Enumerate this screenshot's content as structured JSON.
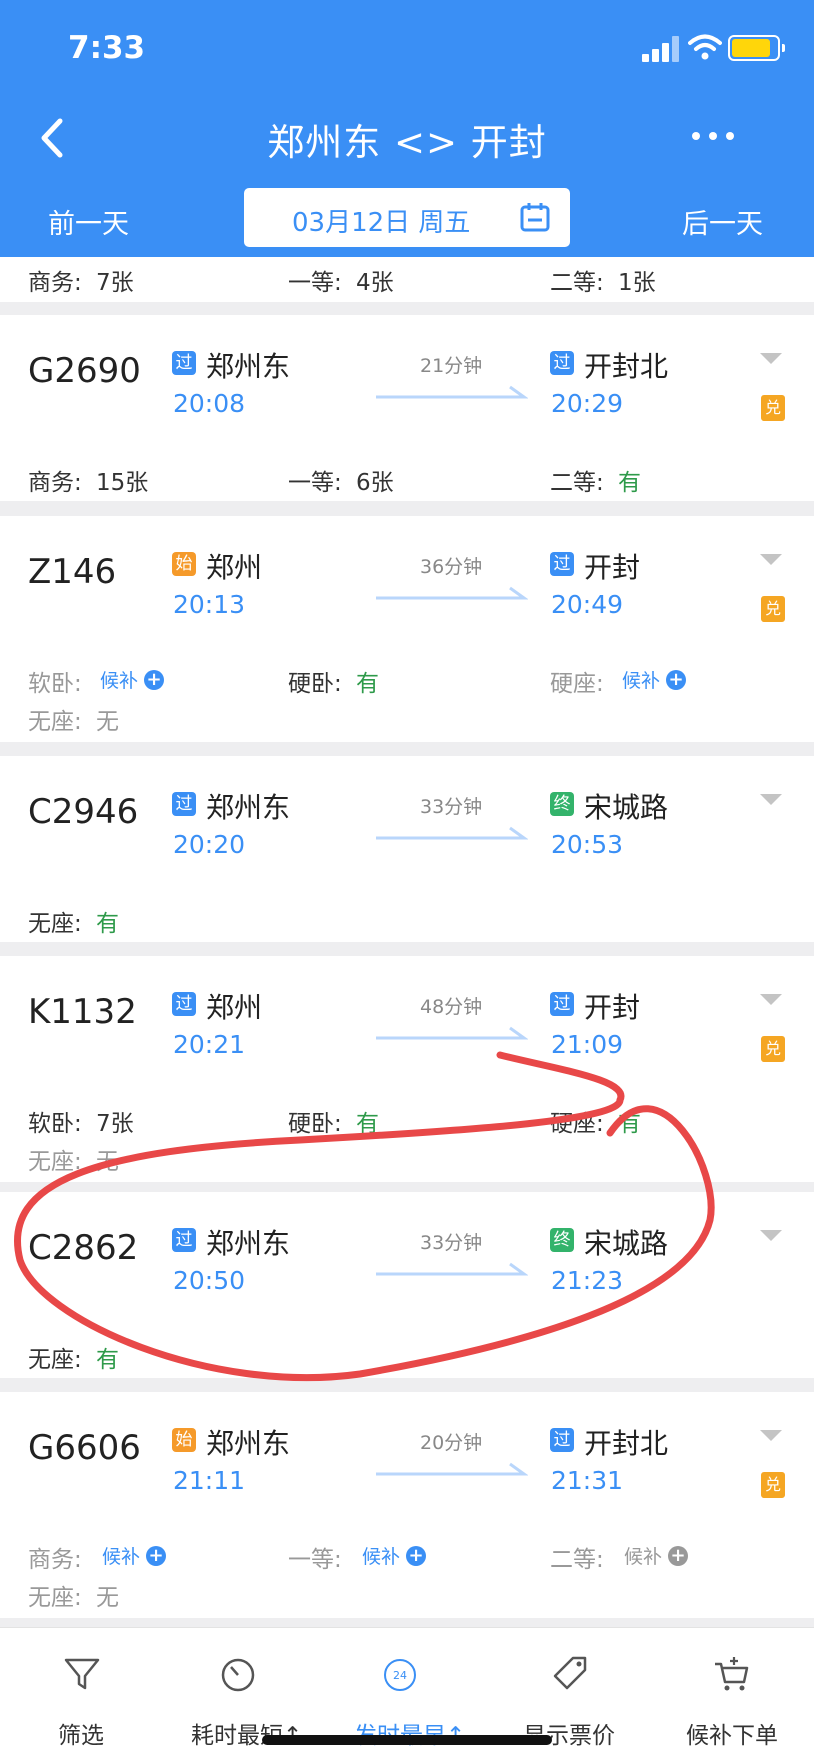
{
  "status_bar": {
    "time": "7:33"
  },
  "header": {
    "title": "郑州东 <> 开封",
    "prev_day": "前一天",
    "next_day": "后一天",
    "date": "03月12日 周五"
  },
  "partial_row": {
    "seats": [
      {
        "label": "商务:",
        "value": "7张",
        "status": "gray"
      },
      {
        "label": "一等:",
        "value": "4张",
        "status": "gray"
      },
      {
        "label": "二等:",
        "value": "1张",
        "status": "gray"
      }
    ]
  },
  "trains": [
    {
      "number": "G2690",
      "from_badge": "过",
      "from_type": "pass",
      "from": "郑州东",
      "dep": "20:08",
      "duration": "21分钟",
      "to_badge": "过",
      "to_type": "pass",
      "to": "开封北",
      "arr": "20:29",
      "exchange": "兑",
      "seats_row1": [
        {
          "label": "商务:",
          "value": "15张",
          "status": "gray"
        },
        {
          "label": "一等:",
          "value": "6张",
          "status": "gray"
        },
        {
          "label": "二等:",
          "value": "有",
          "status": "green"
        }
      ]
    },
    {
      "number": "Z146",
      "from_badge": "始",
      "from_type": "start",
      "from": "郑州",
      "dep": "20:13",
      "duration": "36分钟",
      "to_badge": "过",
      "to_type": "pass",
      "to": "开封",
      "arr": "20:49",
      "exchange": "兑",
      "seats_row1": [
        {
          "label": "软卧:",
          "value": "候补",
          "status": "waitlist"
        },
        {
          "label": "硬卧:",
          "value": "有",
          "status": "green"
        },
        {
          "label": "硬座:",
          "value": "候补",
          "status": "waitlist"
        }
      ],
      "seats_row2": [
        {
          "label": "无座:",
          "value": "无",
          "status": "none"
        }
      ]
    },
    {
      "number": "C2946",
      "from_badge": "过",
      "from_type": "pass",
      "from": "郑州东",
      "dep": "20:20",
      "duration": "33分钟",
      "to_badge": "终",
      "to_type": "end",
      "to": "宋城路",
      "arr": "20:53",
      "seats_row1": [
        {
          "label": "无座:",
          "value": "有",
          "status": "green"
        }
      ]
    },
    {
      "number": "K1132",
      "from_badge": "过",
      "from_type": "pass",
      "from": "郑州",
      "dep": "20:21",
      "duration": "48分钟",
      "to_badge": "过",
      "to_type": "pass",
      "to": "开封",
      "arr": "21:09",
      "exchange": "兑",
      "seats_row1": [
        {
          "label": "软卧:",
          "value": "7张",
          "status": "gray"
        },
        {
          "label": "硬卧:",
          "value": "有",
          "status": "green"
        },
        {
          "label": "硬座:",
          "value": "有",
          "status": "green"
        }
      ],
      "seats_row2": [
        {
          "label": "无座:",
          "value": "无",
          "status": "none"
        }
      ]
    },
    {
      "number": "C2862",
      "from_badge": "过",
      "from_type": "pass",
      "from": "郑州东",
      "dep": "20:50",
      "duration": "33分钟",
      "to_badge": "终",
      "to_type": "end",
      "to": "宋城路",
      "arr": "21:23",
      "seats_row1": [
        {
          "label": "无座:",
          "value": "有",
          "status": "green"
        }
      ]
    },
    {
      "number": "G6606",
      "from_badge": "始",
      "from_type": "start",
      "from": "郑州东",
      "dep": "21:11",
      "duration": "20分钟",
      "to_badge": "过",
      "to_type": "pass",
      "to": "开封北",
      "arr": "21:31",
      "exchange": "兑",
      "seats_row1": [
        {
          "label": "商务:",
          "value": "候补",
          "status": "waitlist"
        },
        {
          "label": "一等:",
          "value": "候补",
          "status": "waitlist"
        },
        {
          "label": "二等:",
          "value": "候补",
          "status": "waitlist-gray"
        }
      ],
      "seats_row2": [
        {
          "label": "无座:",
          "value": "无",
          "status": "none"
        }
      ]
    }
  ],
  "bottom_tabs": [
    {
      "label": "筛选",
      "icon": "filter-icon",
      "active": false
    },
    {
      "label": "耗时最短↑",
      "icon": "timer-icon",
      "active": false
    },
    {
      "label": "发时最早↑",
      "icon": "clock-24-icon",
      "active": true,
      "icon_text": "24"
    },
    {
      "label": "显示票价",
      "icon": "price-tag-icon",
      "active": false
    },
    {
      "label": "候补下单",
      "icon": "cart-plus-icon",
      "active": false
    }
  ],
  "colors": {
    "header_blue": "#3a8ff5",
    "available_green": "#2e9a4a",
    "annotation_red": "#e84848",
    "start_orange": "#f59a2a",
    "end_green": "#33b36b"
  }
}
